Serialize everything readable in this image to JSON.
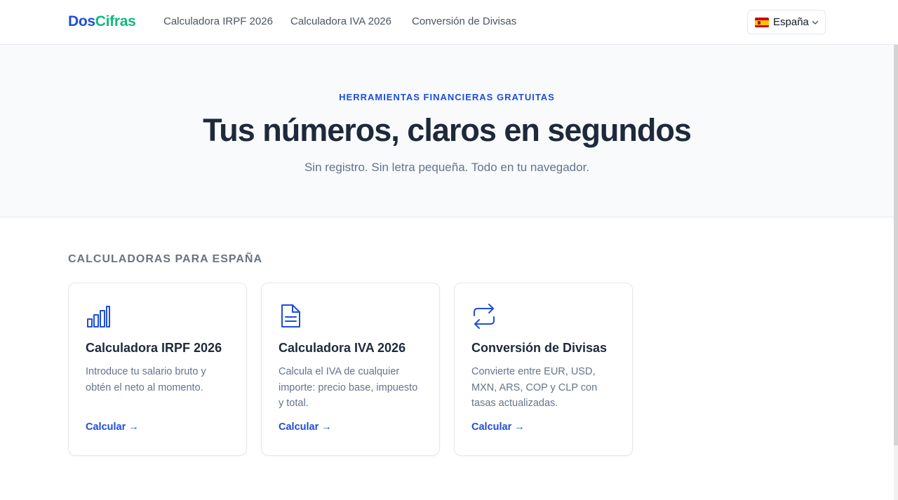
{
  "brand": {
    "part1": "Dos",
    "part2": "Cifras"
  },
  "nav": [
    {
      "label": "Calculadora IRPF 2026"
    },
    {
      "label": "Calculadora IVA 2026"
    },
    {
      "label": "Conversión de Divisas"
    }
  ],
  "country_selector": {
    "label": "España",
    "flag_icon": "spain-flag-icon"
  },
  "hero": {
    "eyebrow": "HERRAMIENTAS FINANCIERAS GRATUITAS",
    "title": "Tus números, claros en segundos",
    "subtitle": "Sin registro. Sin letra pequeña. Todo en tu navegador."
  },
  "section": {
    "title": "CALCULADORAS PARA ESPAÑA"
  },
  "cards": [
    {
      "icon": "bar-chart-icon",
      "title": "Calculadora IRPF 2026",
      "description": "Introduce tu salario bruto y obtén el neto al momento.",
      "cta": "Calcular →"
    },
    {
      "icon": "document-icon",
      "title": "Calculadora IVA 2026",
      "description": "Calcula el IVA de cualquier importe: precio base, impuesto y total.",
      "cta": "Calcular →"
    },
    {
      "icon": "exchange-arrows-icon",
      "title": "Conversión de Divisas",
      "description": "Convierte entre EUR, USD, MXN, ARS, COP y CLP con tasas actualizadas.",
      "cta": "Calcular →"
    }
  ],
  "colors": {
    "brand_blue": "#1d4ed8",
    "brand_green": "#10b981",
    "text_dark": "#1e293b",
    "text_muted": "#64748b",
    "hero_bg": "#f8fafc"
  }
}
